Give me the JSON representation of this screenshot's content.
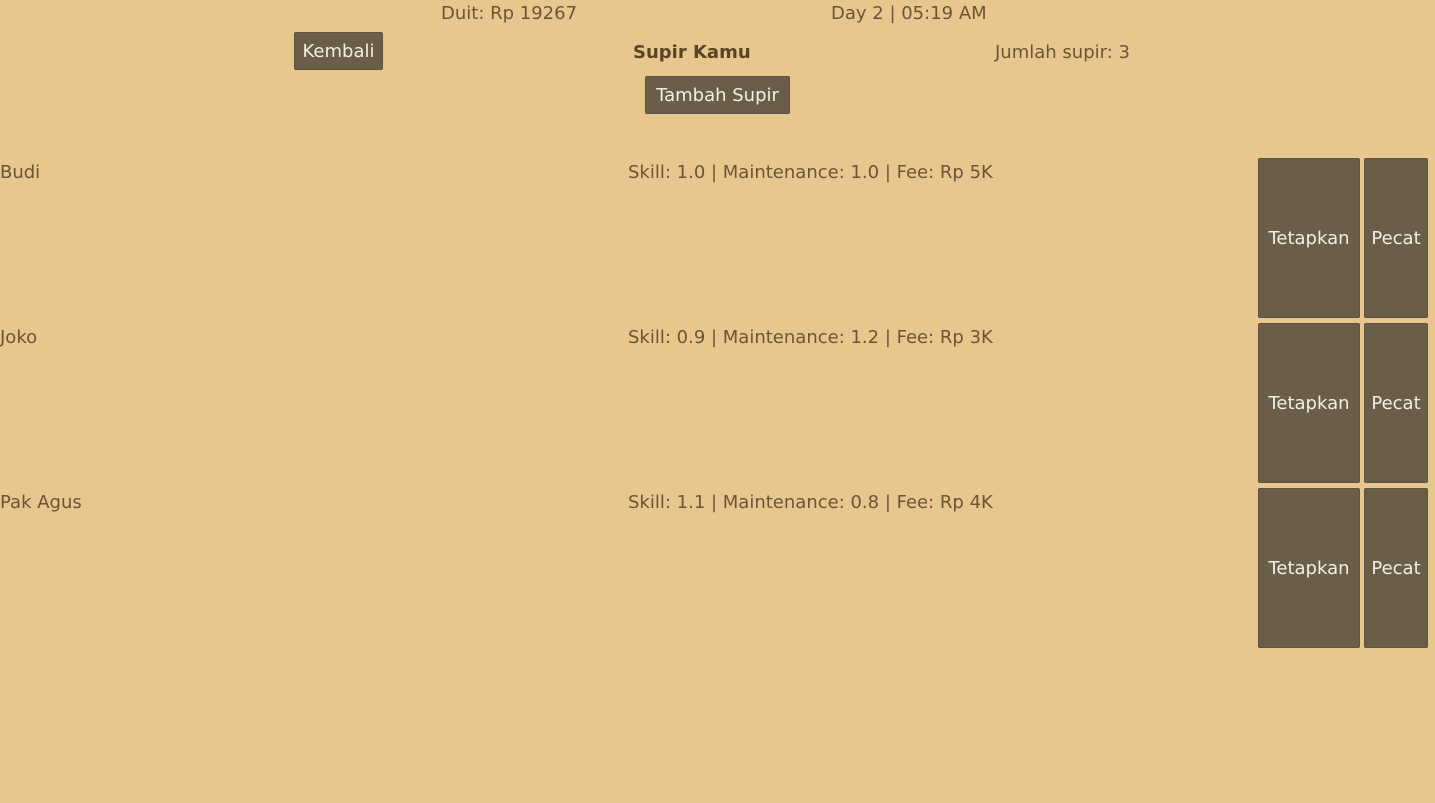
{
  "hud": {
    "money": "Duit: Rp 19267",
    "time": "Day 2 | 05:19 AM"
  },
  "header": {
    "back_label": "Kembali",
    "title": "Supir Kamu",
    "driver_count": "Jumlah supir: 3",
    "add_label": "Tambah Supir"
  },
  "drivers": [
    {
      "name": "Budi",
      "stats": "Skill: 1.0 | Maintenance: 1.0 | Fee: Rp 5K",
      "assign_label": "Tetapkan",
      "fire_label": "Pecat"
    },
    {
      "name": "Joko",
      "stats": "Skill: 0.9 | Maintenance: 1.2 | Fee: Rp 3K",
      "assign_label": "Tetapkan",
      "fire_label": "Pecat"
    },
    {
      "name": "Pak Agus",
      "stats": "Skill: 1.1 | Maintenance: 0.8 | Fee: Rp 4K",
      "assign_label": "Tetapkan",
      "fire_label": "Pecat"
    }
  ]
}
